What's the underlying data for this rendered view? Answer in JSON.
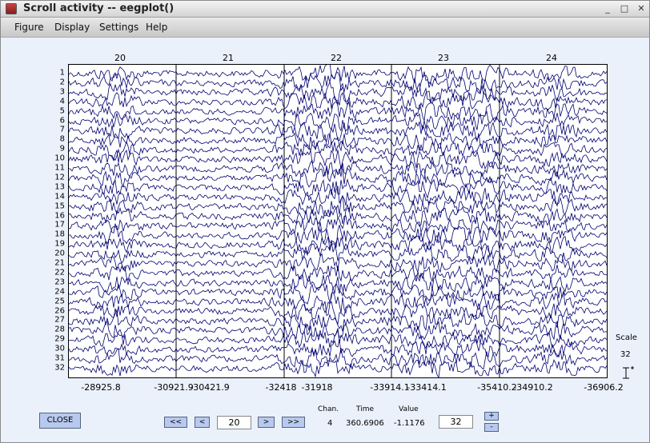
{
  "window": {
    "title": "Scroll activity -- eegplot()",
    "controls": {
      "minimize": "_",
      "maximize": "□",
      "close": "✕"
    }
  },
  "menu": [
    "Figure",
    "Display",
    "Settings",
    "Help"
  ],
  "plot": {
    "top_labels": [
      "20",
      "21",
      "22",
      "23",
      "24"
    ],
    "channel_labels": [
      "1",
      "2",
      "3",
      "4",
      "5",
      "6",
      "7",
      "8",
      "9",
      "10",
      "11",
      "12",
      "13",
      "14",
      "15",
      "16",
      "17",
      "18",
      "19",
      "20",
      "21",
      "22",
      "23",
      "24",
      "25",
      "26",
      "27",
      "28",
      "29",
      "30",
      "31",
      "32"
    ],
    "x_ticks": [
      "-28925.8",
      "-30921.9",
      "-30421.9",
      "-32418",
      "-31918",
      "-33914.1",
      "-33414.1",
      "-35410.2",
      "-34910.2",
      "-36906.2"
    ],
    "trace_color": "#000070",
    "scale_label": "Scale",
    "scale_value": "32",
    "scale_icon": "scale-bar-icon"
  },
  "controls": {
    "close_label": "CLOSE",
    "prev_fast": "<<",
    "prev": "<",
    "epoch_value": "20",
    "next": ">",
    "next_fast": ">>",
    "chan_header": "Chan.",
    "time_header": "Time",
    "value_header": "Value",
    "chan_value": "4",
    "time_value": "360.6906",
    "value_value": "-1.1176",
    "scale_input": "32",
    "plus": "+",
    "minus": "-"
  },
  "colors": {
    "background": "#ebf1fb",
    "button": "#b7c9ee",
    "trace": "#000070"
  }
}
